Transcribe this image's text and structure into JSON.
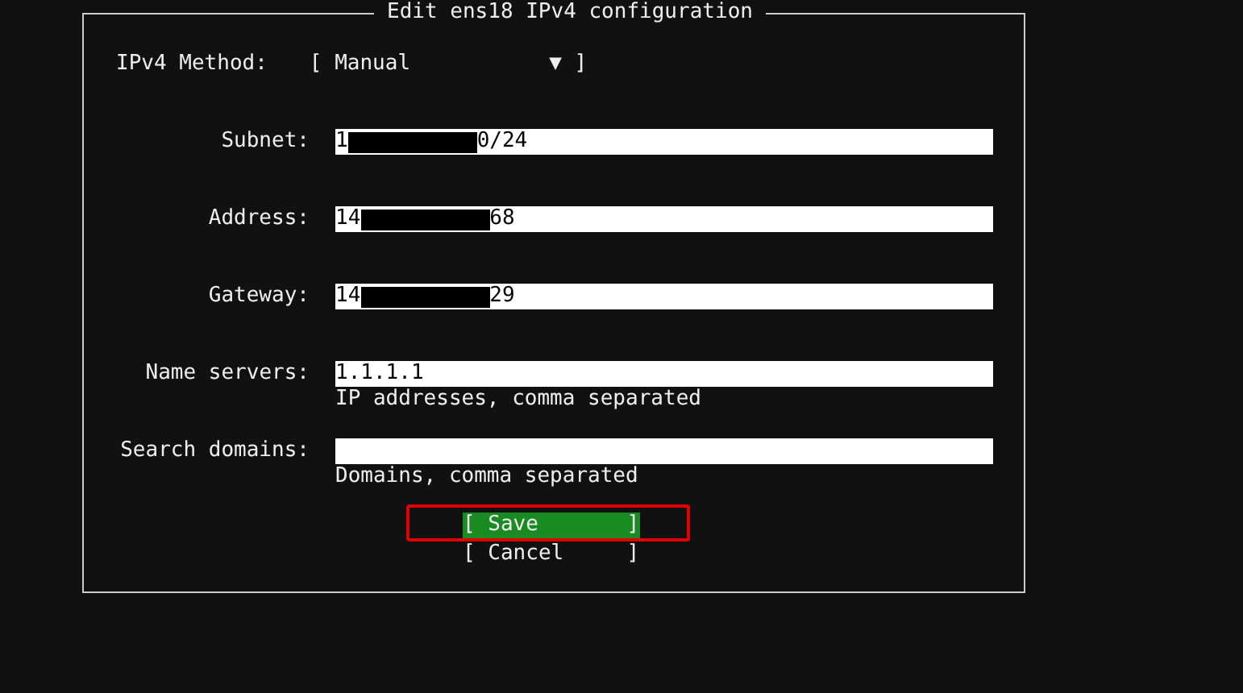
{
  "dialog": {
    "title": "Edit ens18 IPv4 configuration"
  },
  "method": {
    "label": "IPv4 Method:",
    "value": "[ Manual           ▼ ]"
  },
  "fields": [
    {
      "label": "Subnet:",
      "value_parts": [
        {
          "kind": "text",
          "text": "1"
        },
        {
          "kind": "redaction"
        },
        {
          "kind": "text",
          "text": "0/24"
        }
      ]
    },
    {
      "label": "Address:",
      "value_parts": [
        {
          "kind": "text",
          "text": "14"
        },
        {
          "kind": "redaction"
        },
        {
          "kind": "text",
          "text": "68"
        }
      ]
    },
    {
      "label": "Gateway:",
      "value_parts": [
        {
          "kind": "text",
          "text": "14"
        },
        {
          "kind": "redaction"
        },
        {
          "kind": "text",
          "text": "29"
        }
      ]
    },
    {
      "label": "Name servers:",
      "value_parts": [
        {
          "kind": "text",
          "text": "1.1.1.1"
        }
      ],
      "hint": "IP addresses, comma separated"
    },
    {
      "label": "Search domains:",
      "hint": "Domains, comma separated"
    }
  ],
  "buttons": [
    {
      "label": "[ Save       ]",
      "selected": true,
      "highlighted": true
    },
    {
      "label": "[ Cancel     ]",
      "selected": false,
      "highlighted": false
    }
  ]
}
